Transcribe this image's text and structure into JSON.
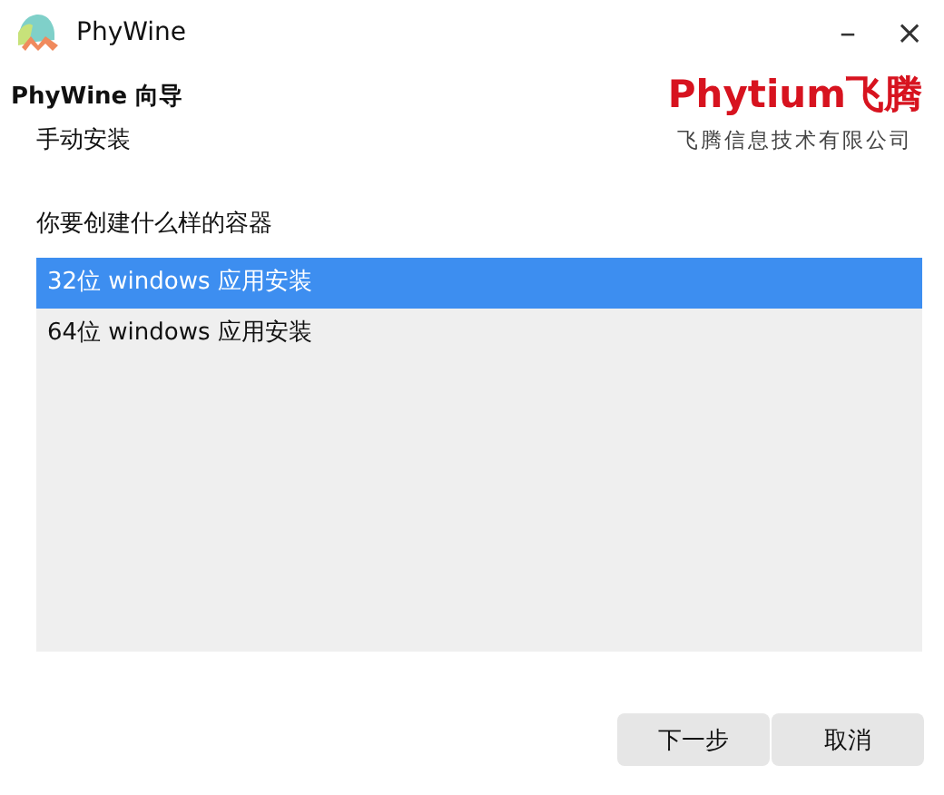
{
  "window": {
    "title": "PhyWine",
    "controls": [
      "–",
      "×"
    ]
  },
  "header": {
    "title": "PhyWine 向导",
    "subtitle": "手动安装",
    "logo": {
      "brand": "Phytium飞腾",
      "company": "飞腾信息技术有限公司"
    }
  },
  "question": "你要创建什么样的容器",
  "options": [
    {
      "label": "32位 windows 应用安装",
      "selected": true
    },
    {
      "label": "64位 windows 应用安装",
      "selected": false
    }
  ],
  "buttons": [
    "下一步",
    "取消"
  ]
}
